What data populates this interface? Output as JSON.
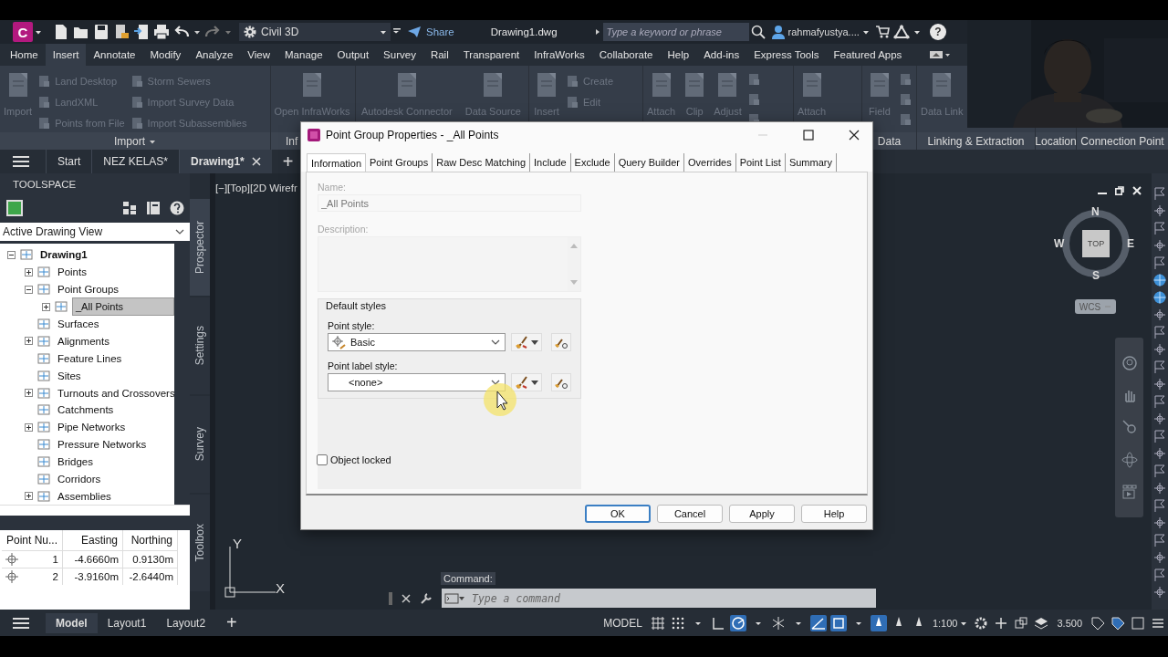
{
  "quick_access": {
    "app_button": "C",
    "workspace": "Civil 3D",
    "share": "Share",
    "file_title": "Drawing1.dwg",
    "search": {
      "placeholder": "Type a keyword or phrase"
    },
    "user": "rahmafyustya....",
    "help": "?"
  },
  "menu_tabs": [
    {
      "label": "Home",
      "selected": false
    },
    {
      "label": "Insert",
      "selected": true
    },
    {
      "label": "Annotate",
      "selected": false
    },
    {
      "label": "Modify",
      "selected": false
    },
    {
      "label": "Analyze",
      "selected": false
    },
    {
      "label": "View",
      "selected": false
    },
    {
      "label": "Manage",
      "selected": false
    },
    {
      "label": "Output",
      "selected": false
    },
    {
      "label": "Survey",
      "selected": false
    },
    {
      "label": "Rail",
      "selected": false
    },
    {
      "label": "Transparent",
      "selected": false
    },
    {
      "label": "InfraWorks",
      "selected": false
    },
    {
      "label": "Collaborate",
      "selected": false
    },
    {
      "label": "Help",
      "selected": false
    },
    {
      "label": "Add-ins",
      "selected": false
    },
    {
      "label": "Express Tools",
      "selected": false
    },
    {
      "label": "Featured Apps",
      "selected": false
    }
  ],
  "ribbon": {
    "panels": [
      {
        "label": "Import",
        "menu": true,
        "items": [
          {
            "kind": "large",
            "label": "Import"
          },
          {
            "kind": "column",
            "items": [
              "Land Desktop",
              "LandXML",
              "Points from File"
            ]
          },
          {
            "kind": "column",
            "items": [
              "Storm Sewers",
              "Import Survey Data",
              "Import Subassemblies"
            ]
          }
        ]
      },
      {
        "label": "Inf",
        "items": [
          {
            "kind": "large",
            "label": "Open InfraWorks"
          }
        ]
      },
      {
        "items": [
          {
            "kind": "large",
            "label": "Autodesk Connector"
          },
          {
            "kind": "large",
            "label": "Data Source"
          }
        ]
      },
      {
        "items": [
          {
            "kind": "large",
            "label": "Insert"
          },
          {
            "kind": "column",
            "items": [
              "Create",
              "Edit"
            ]
          }
        ]
      },
      {
        "items": [
          {
            "kind": "large",
            "label": "Attach"
          },
          {
            "kind": "large",
            "label": "Clip"
          },
          {
            "kind": "large",
            "label": "Adjust"
          },
          {
            "kind": "icons"
          }
        ]
      },
      {
        "items": [
          {
            "kind": "large",
            "label": "Attach"
          }
        ]
      },
      {
        "label": "Data",
        "items": [
          {
            "kind": "large",
            "label": "Field"
          },
          {
            "kind": "icons"
          }
        ]
      },
      {
        "label": "Linking & Extraction",
        "items": [
          {
            "kind": "large",
            "label": "Data Link"
          }
        ]
      },
      {
        "label": "Location"
      },
      {
        "label": "Connection Point"
      }
    ]
  },
  "file_tabs": {
    "items": [
      {
        "label": "Start",
        "selected": false
      },
      {
        "label": "NEZ KELAS*",
        "selected": false
      },
      {
        "label": "Drawing1*",
        "selected": true
      }
    ],
    "add": "+"
  },
  "toolspace": {
    "title": "TOOLSPACE",
    "view": "Active Drawing View",
    "tree": [
      {
        "label": "Drawing1",
        "selected": false,
        "expanded": true,
        "children": [
          {
            "label": "Points",
            "selected": false,
            "expanded": false
          },
          {
            "label": "Point Groups",
            "selected": false,
            "expanded": true,
            "children": [
              {
                "label": "_All Points",
                "selected": true,
                "expanded": false
              }
            ]
          },
          {
            "label": "Surfaces",
            "selected": false
          },
          {
            "label": "Alignments",
            "selected": false,
            "expanded": false
          },
          {
            "label": "Feature Lines",
            "selected": false
          },
          {
            "label": "Sites",
            "selected": false
          },
          {
            "label": "Turnouts and Crossovers",
            "selected": false,
            "expanded": false
          },
          {
            "label": "Catchments",
            "selected": false
          },
          {
            "label": "Pipe Networks",
            "selected": false,
            "expanded": false
          },
          {
            "label": "Pressure Networks",
            "selected": false
          },
          {
            "label": "Bridges",
            "selected": false
          },
          {
            "label": "Corridors",
            "selected": false
          },
          {
            "label": "Assemblies",
            "selected": false,
            "expanded": false
          }
        ]
      }
    ],
    "side_tabs": [
      {
        "label": "Prospector",
        "selected": true
      },
      {
        "label": "Settings",
        "selected": false
      },
      {
        "label": "Survey",
        "selected": false
      },
      {
        "label": "Toolbox",
        "selected": false
      }
    ],
    "point_table": {
      "columns": [
        "Point Nu...",
        "Easting",
        "Northing"
      ],
      "rows": [
        [
          "1",
          "-4.6660m",
          "0.9130m"
        ],
        [
          "2",
          "-3.9160m",
          "-2.6440m"
        ]
      ]
    }
  },
  "viewport": {
    "header": "[−][Top][2D Wirefr",
    "viewcube": {
      "top": "TOP",
      "north": "N",
      "south": "S",
      "east": "E",
      "west": "W",
      "ucs": "WCS"
    },
    "ucs_icon": {
      "x": "X",
      "y": "Y"
    }
  },
  "command_line": {
    "label": "Command:",
    "placeholder": "Type a command"
  },
  "status_bar": {
    "layout_tabs": [
      {
        "label": "Model",
        "selected": true
      },
      {
        "label": "Layout1",
        "selected": false
      },
      {
        "label": "Layout2",
        "selected": false
      }
    ],
    "add": "+",
    "space": "MODEL",
    "scale": "1:100",
    "value": "3.500"
  },
  "dialog": {
    "title": "Point Group Properties - _All Points",
    "tabs": [
      {
        "label": "Information",
        "selected": true
      },
      {
        "label": "Point Groups",
        "selected": false
      },
      {
        "label": "Raw Desc Matching",
        "selected": false
      },
      {
        "label": "Include",
        "selected": false
      },
      {
        "label": "Exclude",
        "selected": false
      },
      {
        "label": "Query Builder",
        "selected": false
      },
      {
        "label": "Overrides",
        "selected": false
      },
      {
        "label": "Point List",
        "selected": false
      },
      {
        "label": "Summary",
        "selected": false
      }
    ],
    "name": {
      "label": "Name:",
      "value": "_All Points",
      "disabled": true
    },
    "description": {
      "label": "Description:",
      "disabled": true
    },
    "default_styles": {
      "title": "Default styles",
      "fields": [
        {
          "label": "Point style:",
          "value": "Basic"
        },
        {
          "label": "Point label style:",
          "value": "<none>"
        }
      ]
    },
    "object_locked": {
      "label": "Object locked",
      "checked": false
    },
    "buttons": [
      {
        "label": "OK",
        "default": true
      },
      {
        "label": "Cancel",
        "default": false
      },
      {
        "label": "Apply",
        "default": false
      },
      {
        "label": "Help",
        "default": false
      }
    ]
  }
}
